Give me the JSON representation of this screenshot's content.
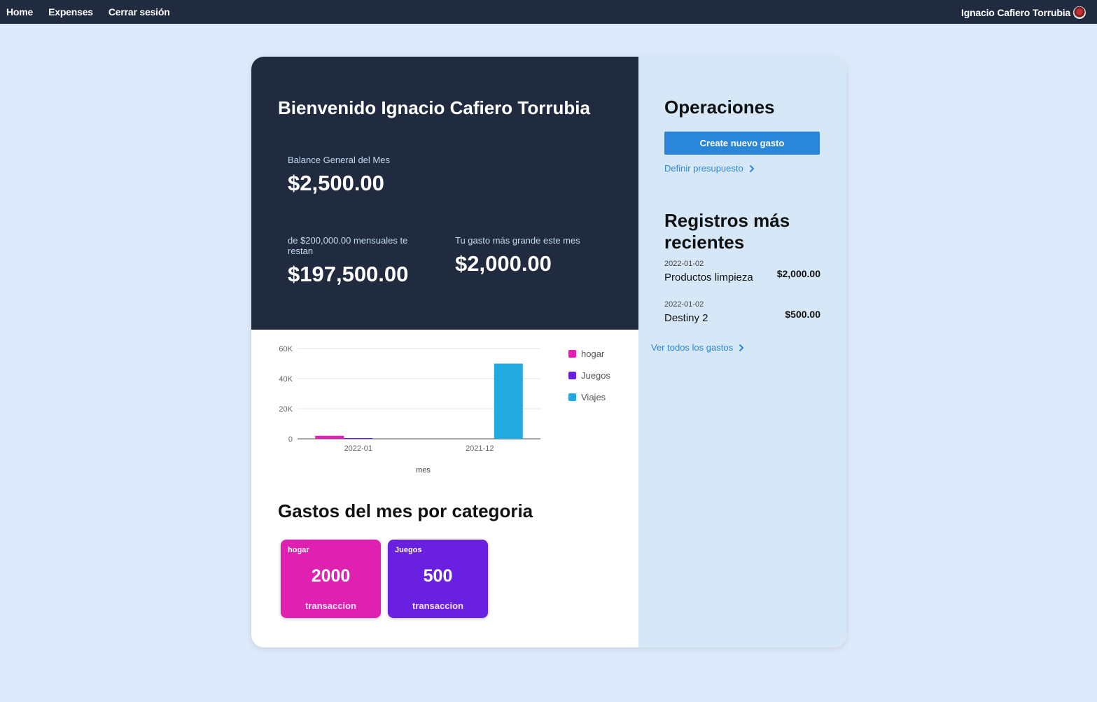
{
  "nav": {
    "links": [
      "Home",
      "Expenses",
      "Cerrar sesión"
    ],
    "user_name": "Ignacio Cafiero Torrubia"
  },
  "dashboard": {
    "welcome": "Bienvenido Ignacio Cafiero Torrubia",
    "balance_label": "Balance General del Mes",
    "balance_value": "$2,500.00",
    "remaining_label": "de $200,000.00 mensuales te restan",
    "remaining_value": "$197,500.00",
    "largest_label": "Tu gasto más grande este mes",
    "largest_value": "$2,000.00"
  },
  "chart_data": {
    "type": "bar",
    "categories": [
      "2022-01",
      "2021-12"
    ],
    "series": [
      {
        "name": "hogar",
        "values": [
          2000,
          0
        ],
        "color": "#e020b2"
      },
      {
        "name": "Juegos",
        "values": [
          500,
          0
        ],
        "color": "#6a1fe0"
      },
      {
        "name": "Viajes",
        "values": [
          0,
          50000
        ],
        "color": "#22a9e0"
      }
    ],
    "xlabel": "mes",
    "ylabel": "",
    "ylim": [
      0,
      60000
    ],
    "yticks": [
      "0",
      "20K",
      "40K",
      "60K"
    ],
    "ytick_values": [
      0,
      20000,
      40000,
      60000
    ],
    "grid": true,
    "legend": "right"
  },
  "categories_section": {
    "title": "Gastos del mes por categoria",
    "cards": [
      {
        "name": "hogar",
        "value": "2000",
        "caption": "transaccion",
        "color": "#df20b1"
      },
      {
        "name": "Juegos",
        "value": "500",
        "caption": "transaccion",
        "color": "#6a20e0"
      }
    ]
  },
  "operations": {
    "title": "Operaciones",
    "create_button": "Create nuevo gasto",
    "budget_link": "Definir presupuesto"
  },
  "recent": {
    "title": "Registros más recientes",
    "items": [
      {
        "date": "2022-01-02",
        "name": "Productos limpieza",
        "amount": "$2,000.00"
      },
      {
        "date": "2022-01-02",
        "name": "Destiny 2",
        "amount": "$500.00"
      }
    ],
    "view_all": "Ver todos los gastos"
  },
  "icons": {
    "chevron": "chevron-right-icon",
    "avatar": "avatar-icon"
  }
}
